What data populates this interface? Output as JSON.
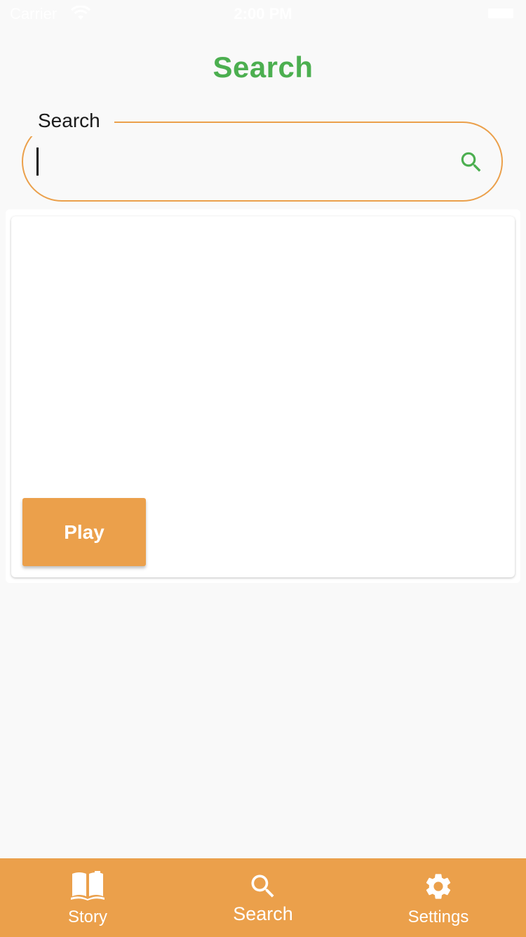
{
  "status_bar": {
    "carrier": "Carrier",
    "time": "2:00 PM"
  },
  "header": {
    "title": "Search",
    "title_color": "#4caf50"
  },
  "search": {
    "label": "Search",
    "value": "",
    "icon": "search-icon",
    "border_color": "#eba04b",
    "icon_color": "#4caf50"
  },
  "card": {
    "play_label": "Play"
  },
  "bottom_nav": {
    "background": "#eba04b",
    "items": [
      {
        "label": "Story",
        "icon": "book-icon"
      },
      {
        "label": "Search",
        "icon": "search-icon",
        "active": true
      },
      {
        "label": "Settings",
        "icon": "gear-icon"
      }
    ]
  }
}
